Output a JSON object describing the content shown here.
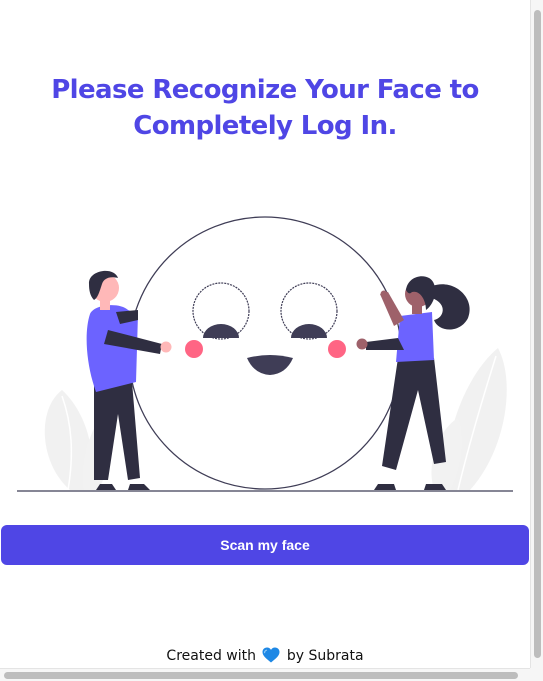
{
  "page": {
    "title": "Please Recognize Your Face to Completely Log In."
  },
  "illustration": {
    "icon": "face-scan-illustration"
  },
  "scan_button": {
    "label": "Scan my face"
  },
  "footer": {
    "prefix": "Created with",
    "heart_icon": "blue-heart-icon",
    "suffix": "by Subrata"
  },
  "colors": {
    "accent": "#4f46e5",
    "figure_purple": "#6c63ff",
    "dark": "#2f2e41",
    "cheek": "#ff6584",
    "heart": "#1e88e5"
  }
}
